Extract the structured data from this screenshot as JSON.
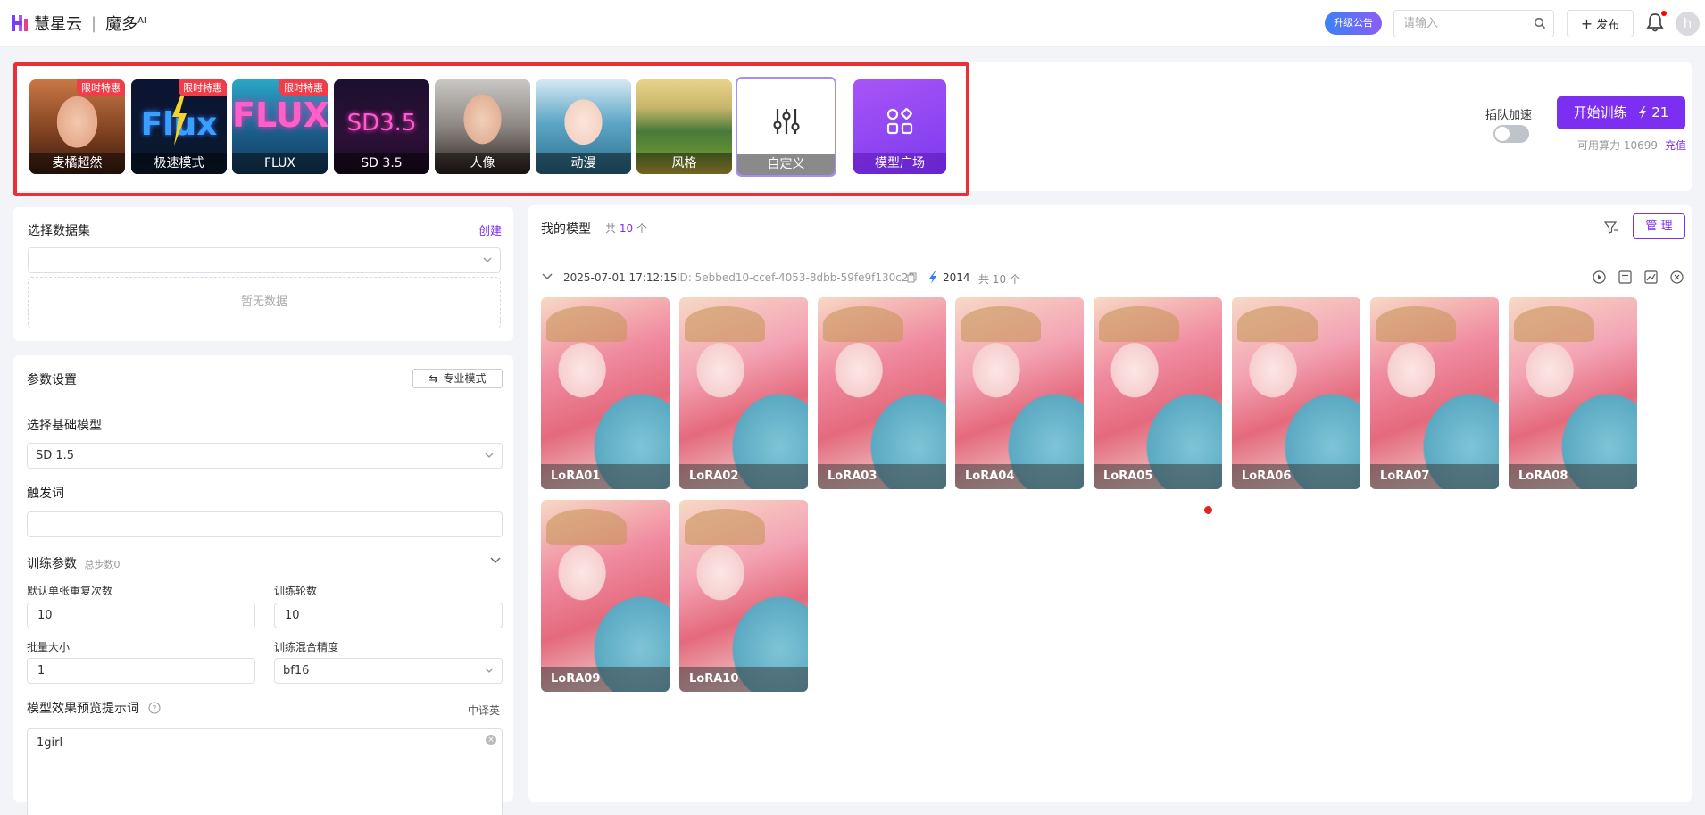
{
  "header": {
    "brand_name": "慧星云",
    "product_name": "魔多",
    "product_sup": "AI",
    "upgrade_label": "升级公告",
    "search_placeholder": "请输入",
    "publish_label": "发布",
    "avatar_letter": "h"
  },
  "model_cards": [
    {
      "label": "麦橘超然",
      "badge": "限时特惠"
    },
    {
      "label": "极速模式",
      "badge": "限时特惠"
    },
    {
      "label": "FLUX",
      "badge": "限时特惠"
    },
    {
      "label": "SD 3.5",
      "badge": ""
    },
    {
      "label": "人像",
      "badge": ""
    },
    {
      "label": "动漫",
      "badge": ""
    },
    {
      "label": "风格",
      "badge": ""
    },
    {
      "label": "自定义",
      "badge": "",
      "selected": true
    },
    {
      "label": "模型广场",
      "badge": ""
    }
  ],
  "flux_art_text": "Flux",
  "flux_art_text_2": "FLUX",
  "sd_art_text": "SD3.5",
  "training": {
    "queue_label": "插队加速",
    "queue_enabled": false,
    "start_label": "开始训练",
    "cost": "21",
    "compute_label": "可用算力",
    "compute_value": "10699",
    "recharge_label": "充值"
  },
  "dataset": {
    "title": "选择数据集",
    "create_label": "创建",
    "selected": "",
    "empty_text": "暂无数据"
  },
  "params": {
    "title": "参数设置",
    "pro_mode_label": "专业模式",
    "base_model_label": "选择基础模型",
    "base_model_value": "SD 1.5",
    "trigger_label": "触发词",
    "trigger_value": "",
    "train_params_label": "训练参数",
    "total_steps": "总步数0",
    "repeat_label": "默认单张重复次数",
    "repeat_value": "10",
    "epochs_label": "训练轮数",
    "epochs_value": "10",
    "batch_label": "批量大小",
    "batch_value": "1",
    "precision_label": "训练混合精度",
    "precision_value": "bf16",
    "preview_prompt_label": "模型效果预览提示词",
    "translate_label": "中译英",
    "preview_prompt_value": "1girl"
  },
  "my_models": {
    "title": "我的模型",
    "count_prefix": "共",
    "count": "10",
    "count_suffix": "个",
    "manage_label": "管 理",
    "group": {
      "timestamp": "2025-07-01 17:12:15",
      "id": "ID: 5ebbed10-ccef-4053-8dbb-59fe9f130c20",
      "cost": "2014",
      "count_text": "共 10 个"
    },
    "items": [
      "LoRA01",
      "LoRA02",
      "LoRA03",
      "LoRA04",
      "LoRA05",
      "LoRA06",
      "LoRA07",
      "LoRA08",
      "LoRA09",
      "LoRA10"
    ]
  },
  "colors": {
    "accent": "#7c2ff0",
    "badge": "#ef3e4a",
    "highlight_frame": "#ec2f36"
  },
  "icons": [
    "search-icon",
    "plus-icon",
    "bell-icon",
    "slider-icon",
    "grid-icon",
    "lightning-icon",
    "swap-icon",
    "chevron-down-icon",
    "help-icon",
    "close-icon",
    "copy-icon",
    "filter-icon",
    "history-icon",
    "list-icon",
    "chart-icon"
  ]
}
